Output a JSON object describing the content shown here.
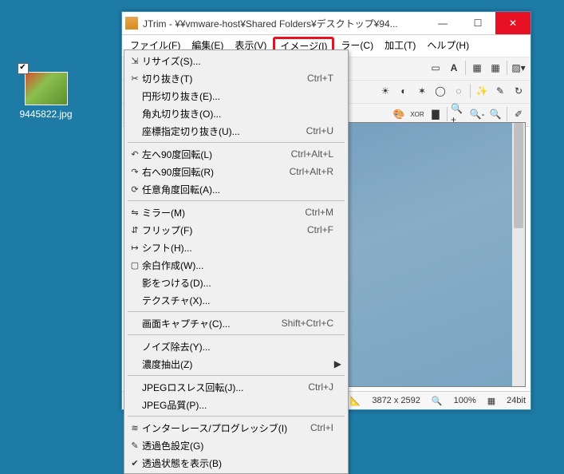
{
  "desktop": {
    "filename": "9445822.jpg"
  },
  "window": {
    "title": "JTrim - ¥¥vmware-host¥Shared Folders¥デスクトップ¥94..."
  },
  "winbuttons": {
    "min": "—",
    "max": "☐",
    "close": "✕"
  },
  "menubar": [
    "ファイル(F)",
    "編集(E)",
    "表示(V)",
    "イメージ(I)",
    "ラー(C)",
    "加工(T)",
    "ヘルプ(H)"
  ],
  "dropdown": {
    "groups": [
      [
        {
          "icon": "⇲",
          "label": "リサイズ(S)...",
          "accel": "",
          "arrow": false
        },
        {
          "icon": "✂",
          "label": "切り抜き(T)",
          "accel": "Ctrl+T",
          "arrow": false
        },
        {
          "icon": "",
          "label": "円形切り抜き(E)...",
          "accel": "",
          "arrow": false
        },
        {
          "icon": "",
          "label": "角丸切り抜き(O)...",
          "accel": "",
          "arrow": false
        },
        {
          "icon": "",
          "label": "座標指定切り抜き(U)...",
          "accel": "Ctrl+U",
          "arrow": false
        }
      ],
      [
        {
          "icon": "↶",
          "label": "左へ90度回転(L)",
          "accel": "Ctrl+Alt+L",
          "arrow": false
        },
        {
          "icon": "↷",
          "label": "右へ90度回転(R)",
          "accel": "Ctrl+Alt+R",
          "arrow": false
        },
        {
          "icon": "⟳",
          "label": "任意角度回転(A)...",
          "accel": "",
          "arrow": false
        }
      ],
      [
        {
          "icon": "⇋",
          "label": "ミラー(M)",
          "accel": "Ctrl+M",
          "arrow": false
        },
        {
          "icon": "⇵",
          "label": "フリップ(F)",
          "accel": "Ctrl+F",
          "arrow": false
        },
        {
          "icon": "↦",
          "label": "シフト(H)...",
          "accel": "",
          "arrow": false
        },
        {
          "icon": "▢",
          "label": "余白作成(W)...",
          "accel": "",
          "arrow": false
        },
        {
          "icon": "",
          "label": "影をつける(D)...",
          "accel": "",
          "arrow": false
        },
        {
          "icon": "",
          "label": "テクスチャ(X)...",
          "accel": "",
          "arrow": false
        }
      ],
      [
        {
          "icon": "",
          "label": "画面キャプチャ(C)...",
          "accel": "Shift+Ctrl+C",
          "arrow": false
        }
      ],
      [
        {
          "icon": "",
          "label": "ノイズ除去(Y)...",
          "accel": "",
          "arrow": false
        },
        {
          "icon": "",
          "label": "濃度抽出(Z)",
          "accel": "",
          "arrow": true
        }
      ],
      [
        {
          "icon": "",
          "label": "JPEGロスレス回転(J)...",
          "accel": "Ctrl+J",
          "arrow": false
        },
        {
          "icon": "",
          "label": "JPEG品質(P)...",
          "accel": "",
          "arrow": false
        }
      ],
      [
        {
          "icon": "≋",
          "label": "インターレース/プログレッシブ(I)",
          "accel": "Ctrl+I",
          "arrow": false
        },
        {
          "icon": "✎",
          "label": "透過色設定(G)",
          "accel": "",
          "arrow": false
        },
        {
          "icon": "✔",
          "label": "透過状態を表示(B)",
          "accel": "",
          "arrow": false
        }
      ]
    ]
  },
  "status": {
    "color": "8EBBFE",
    "dims": "3872 x 2592",
    "zoom": "100%",
    "depth": "24bit"
  }
}
